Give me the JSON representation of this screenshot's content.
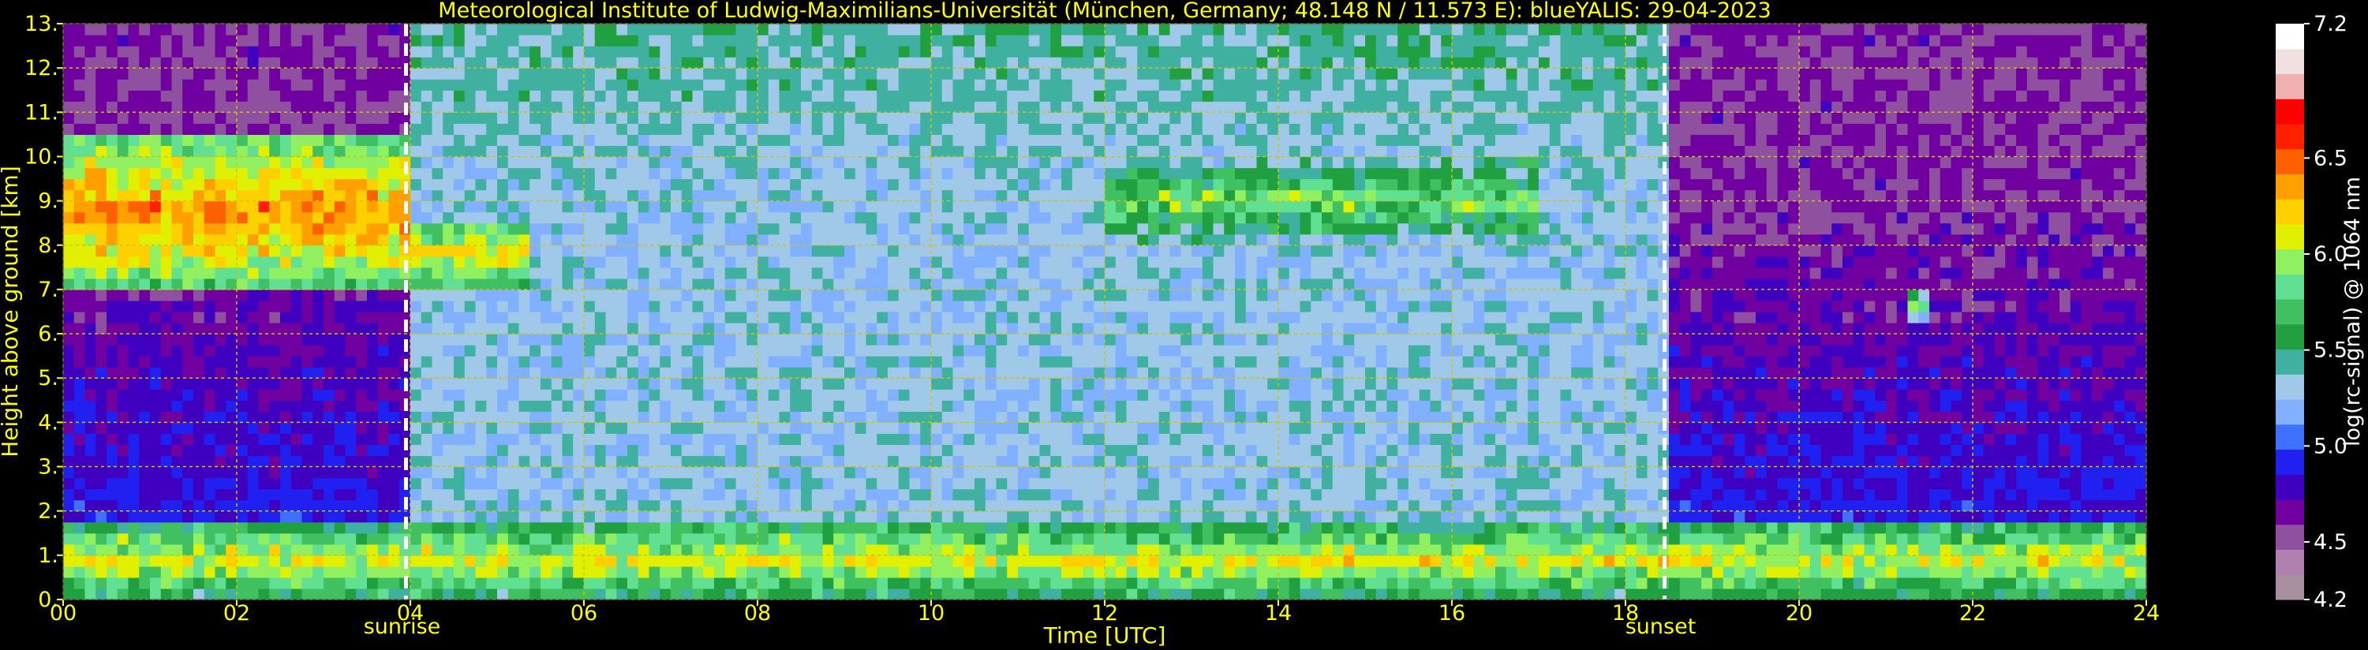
{
  "chart_data": {
    "type": "heatmap",
    "title": "Meteorological Institute of Ludwig-Maximilians-Universität (München, Germany; 48.148 N / 11.573 E):     blueYALIS: 29-04-2023",
    "xlabel": "Time [UTC]",
    "ylabel": "Height above ground [km]",
    "xlim": [
      0,
      24
    ],
    "ylim": [
      0,
      13
    ],
    "x_ticks": [
      "00",
      "02",
      "04",
      "06",
      "08",
      "10",
      "12",
      "14",
      "16",
      "18",
      "20",
      "22",
      "24"
    ],
    "y_ticks": [
      "0.",
      "1.",
      "2.",
      "3.",
      "4.",
      "5.",
      "6.",
      "7.",
      "8.",
      "9.",
      "10.",
      "11.",
      "12.",
      "13."
    ],
    "grid": true,
    "markers": [
      {
        "label": "sunrise",
        "time": 3.95
      },
      {
        "label": "sunset",
        "time": 18.45
      }
    ],
    "colorbar": {
      "label": "log(rc-signal) @ 1064 nm",
      "range": [
        4.2,
        7.2
      ],
      "ticks": [
        "4.2",
        "4.5",
        "5.0",
        "5.5",
        "6.0",
        "6.5",
        "7.2"
      ],
      "tick_values": [
        4.2,
        4.5,
        5.0,
        5.5,
        6.0,
        6.5,
        7.2
      ]
    },
    "features": [
      {
        "name": "cirrus",
        "start": 0.05,
        "end": 3.95,
        "base_km": 7.1,
        "top_km": 10.4,
        "peak": 6.4
      },
      {
        "name": "cirrus",
        "start": 4.0,
        "end": 5.4,
        "base_km": 7.0,
        "top_km": 8.6,
        "peak": 6.2
      },
      {
        "name": "cirrus",
        "start": 12.0,
        "end": 17.0,
        "base_km": 8.0,
        "top_km": 10.0,
        "peak": 5.9
      },
      {
        "name": "cloud",
        "start": 21.3,
        "end": 21.5,
        "base_km": 6.3,
        "top_km": 7.0,
        "peak": 5.9
      },
      {
        "name": "boundary-layer",
        "start": 0.0,
        "end": 24.0,
        "base_km": 0.0,
        "top_km": 1.8,
        "peak": 6.1
      }
    ]
  },
  "colors": {
    "background": "#000000",
    "text": "#ffff00",
    "colorbar_text": "#ffffff",
    "grid": "#c8c800",
    "marker": "#ffffff",
    "colormap": [
      "#a890a0",
      "#b080b0",
      "#9050a0",
      "#7000a0",
      "#4000c0",
      "#2020f0",
      "#4070ff",
      "#80b0ff",
      "#a0c8e8",
      "#40b0a0",
      "#20a040",
      "#40c060",
      "#60e090",
      "#90f060",
      "#e0f000",
      "#ffd000",
      "#ffa000",
      "#ff6000",
      "#ff2000",
      "#ff0000",
      "#f0b0b0",
      "#f0e0e0",
      "#ffffff"
    ]
  }
}
